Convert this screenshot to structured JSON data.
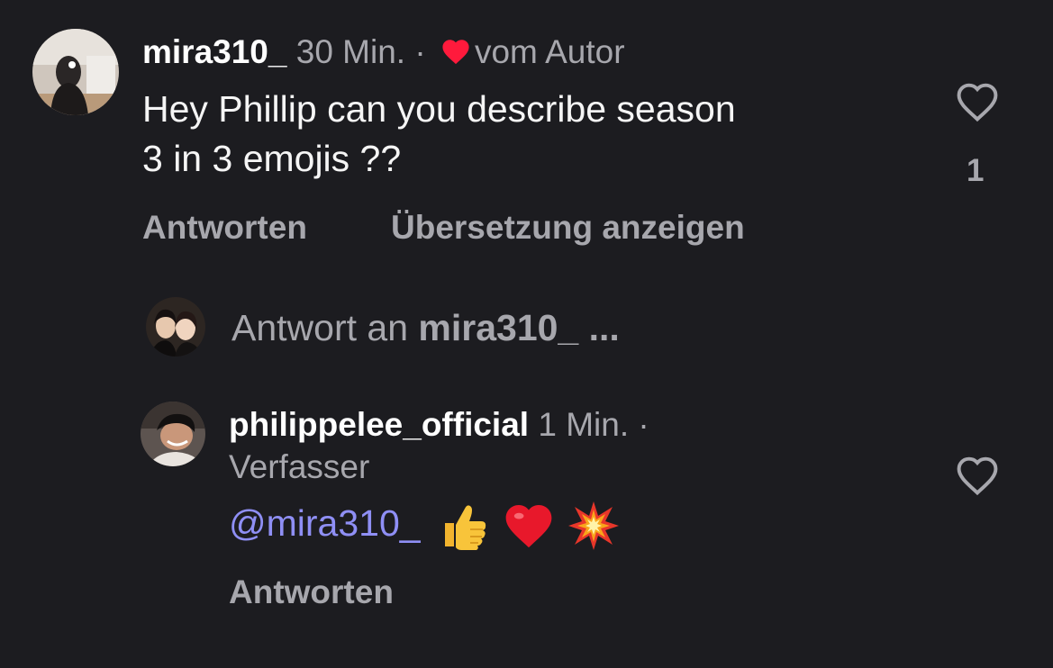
{
  "comment": {
    "username": "mira310_",
    "time": "30 Min.",
    "separator": "·",
    "author_like_label": "vom Autor",
    "text_line1": "Hey Phillip can you describe season",
    "text_line2": "3 in 3 emojis ??",
    "like_count": "1",
    "reply_label": "Antworten",
    "translate_label": "Übersetzung anzeigen"
  },
  "reply_prompt": {
    "prefix": "Antwort an",
    "target": "mira310_",
    "ellipsis": "..."
  },
  "reply": {
    "username": "philippelee_official",
    "time": "1 Min.",
    "separator": "·",
    "role": "Verfasser",
    "mention": "@mira310_",
    "emojis": [
      "thumbs-up",
      "red-heart",
      "collision"
    ],
    "reply_label": "Antworten"
  },
  "colors": {
    "background": "#1c1c20",
    "muted": "#a7a7ad",
    "mention": "#8f8ff5",
    "heart": "#ff1a3c"
  }
}
